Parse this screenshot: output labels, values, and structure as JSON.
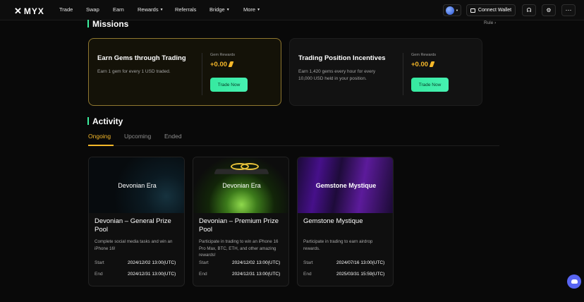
{
  "nav": {
    "logo": "MYX",
    "items": [
      {
        "label": "Trade",
        "caret": false
      },
      {
        "label": "Swap",
        "caret": false
      },
      {
        "label": "Earn",
        "caret": false
      },
      {
        "label": "Rewards",
        "caret": true
      },
      {
        "label": "Referrals",
        "caret": false
      },
      {
        "label": "Bridge",
        "caret": true
      },
      {
        "label": "More",
        "caret": true
      }
    ],
    "connect_wallet": "Connect Wallet",
    "more_icon": "⋯"
  },
  "missions": {
    "title": "Missions",
    "rule": "Rule ›",
    "cards": [
      {
        "title": "Earn Gems through Trading",
        "desc": "Earn 1 gem for every 1 USD traded.",
        "gem_label": "Gem Rewards",
        "gem_value": "+0.00",
        "button": "Trade Now"
      },
      {
        "title": "Trading Position Incentives",
        "desc": "Earn 1,420 gems every hour for every 10,000 USD held in your position.",
        "gem_label": "Gem Rewards",
        "gem_value": "+0.00",
        "button": "Trade Now"
      }
    ]
  },
  "activity": {
    "title": "Activity",
    "tabs": [
      "Ongoing",
      "Upcoming",
      "Ended"
    ],
    "start_label": "Start",
    "end_label": "End",
    "cards": [
      {
        "image_text": "Devonian Era",
        "title": "Devonian – General Prize Pool",
        "desc": "Complete social media tasks and win an iPhone 16!",
        "start": "2024/12/02 13:00(UTC)",
        "end": "2024/12/31 13:00(UTC)"
      },
      {
        "image_text": "Devonian Era",
        "title": "Devonian – Premium Prize Pool",
        "desc": "Participate in trading to win an iPhone 16 Pro Max, BTC, ETH, and other amazing rewards!",
        "start": "2024/12/02 13:00(UTC)",
        "end": "2024/12/31 13:00(UTC)"
      },
      {
        "image_text": "Gemstone Mystique",
        "title": "Gemstone Mystique",
        "desc": "Participate in trading to earn airdrop rewards.",
        "start": "2024/07/16 13:00(UTC)",
        "end": "2025/03/31 15:59(UTC)"
      }
    ]
  },
  "colors": {
    "accent": "#3cf0a0",
    "gold": "#f5b829",
    "background": "#090909"
  }
}
